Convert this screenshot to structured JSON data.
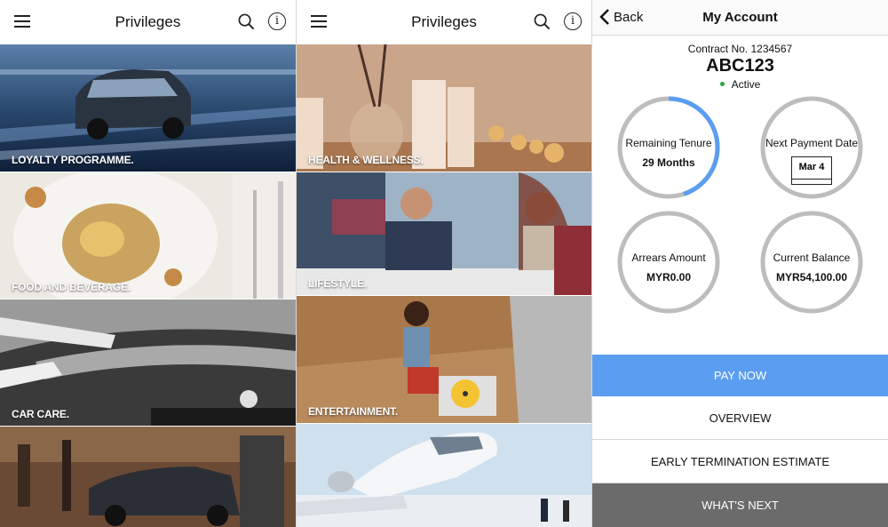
{
  "privileges": {
    "title": "Privileges",
    "tiles_left": [
      {
        "label": "LOYALTY PROGRAMME."
      },
      {
        "label": "FOOD AND BEVERAGE."
      },
      {
        "label": "CAR CARE."
      },
      {
        "label": ""
      }
    ],
    "tiles_mid": [
      {
        "label": "HEALTH & WELLNESS."
      },
      {
        "label": "LIFESTYLE."
      },
      {
        "label": "ENTERTAINMENT."
      },
      {
        "label": ""
      }
    ]
  },
  "account": {
    "back_label": "Back",
    "title": "My Account",
    "contract": "Contract No. 1234567",
    "plate": "ABC123",
    "status": "Active",
    "status_color": "#28a745",
    "remaining_tenure": {
      "label": "Remaining Tenure",
      "value": "29 Months",
      "progress": 0.45
    },
    "next_payment": {
      "label": "Next Payment Date",
      "value": "Mar 4"
    },
    "arrears": {
      "label": "Arrears Amount",
      "value": "MYR0.00"
    },
    "balance": {
      "label": "Current Balance",
      "value": "MYR54,100.00"
    },
    "buttons": {
      "pay_now": "PAY NOW",
      "overview": "OVERVIEW",
      "early_termination": "EARLY TERMINATION ESTIMATE",
      "whats_next": "WHAT'S NEXT"
    },
    "accent_color": "#5b9df0"
  }
}
